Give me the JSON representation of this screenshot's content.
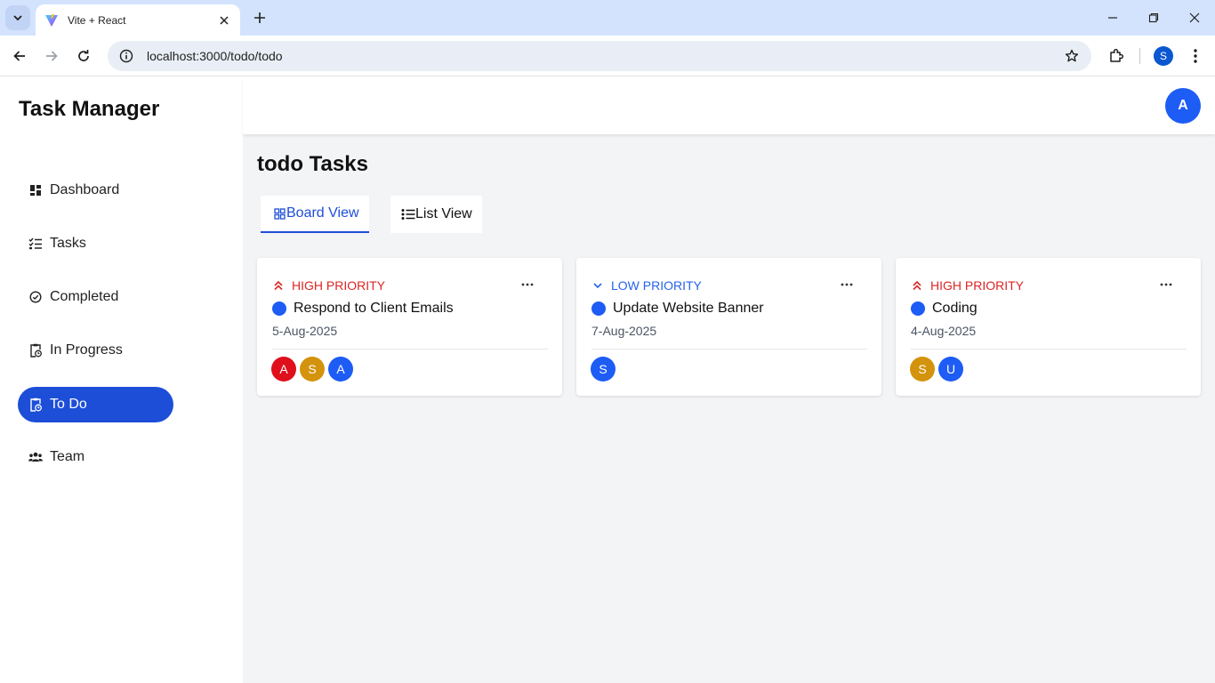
{
  "browser": {
    "tab_title": "Vite + React",
    "url": "localhost:3000/todo/todo",
    "profile_initial": "S"
  },
  "app": {
    "brand": "Task Manager",
    "user_initial": "A",
    "page_title": "todo Tasks",
    "accent_color": "#1d4ed8"
  },
  "sidebar": {
    "items": [
      {
        "label": "Dashboard",
        "icon": "dashboard-icon"
      },
      {
        "label": "Tasks",
        "icon": "checklist-icon"
      },
      {
        "label": "Completed",
        "icon": "check-circle-icon"
      },
      {
        "label": "In Progress",
        "icon": "clipboard-clock-icon"
      },
      {
        "label": "To Do",
        "icon": "clipboard-clock-icon",
        "active": true
      },
      {
        "label": "Team",
        "icon": "users-icon"
      }
    ]
  },
  "views": {
    "board_label": "Board View",
    "list_label": "List View",
    "active": "board"
  },
  "cards": [
    {
      "priority": "HIGH PRIORITY",
      "priority_level": "high",
      "title": "Respond to Client Emails",
      "date": "5-Aug-2025",
      "assignees": [
        {
          "initial": "A",
          "color": "#e00f1c"
        },
        {
          "initial": "S",
          "color": "#d4930d"
        },
        {
          "initial": "A",
          "color": "#1d5cf5"
        }
      ]
    },
    {
      "priority": "LOW PRIORITY",
      "priority_level": "low",
      "title": "Update Website Banner",
      "date": "7-Aug-2025",
      "assignees": [
        {
          "initial": "S",
          "color": "#1d5cf5"
        }
      ]
    },
    {
      "priority": "HIGH PRIORITY",
      "priority_level": "high",
      "title": "Coding",
      "date": "4-Aug-2025",
      "assignees": [
        {
          "initial": "S",
          "color": "#d4930d"
        },
        {
          "initial": "U",
          "color": "#1d5cf5"
        }
      ]
    }
  ]
}
